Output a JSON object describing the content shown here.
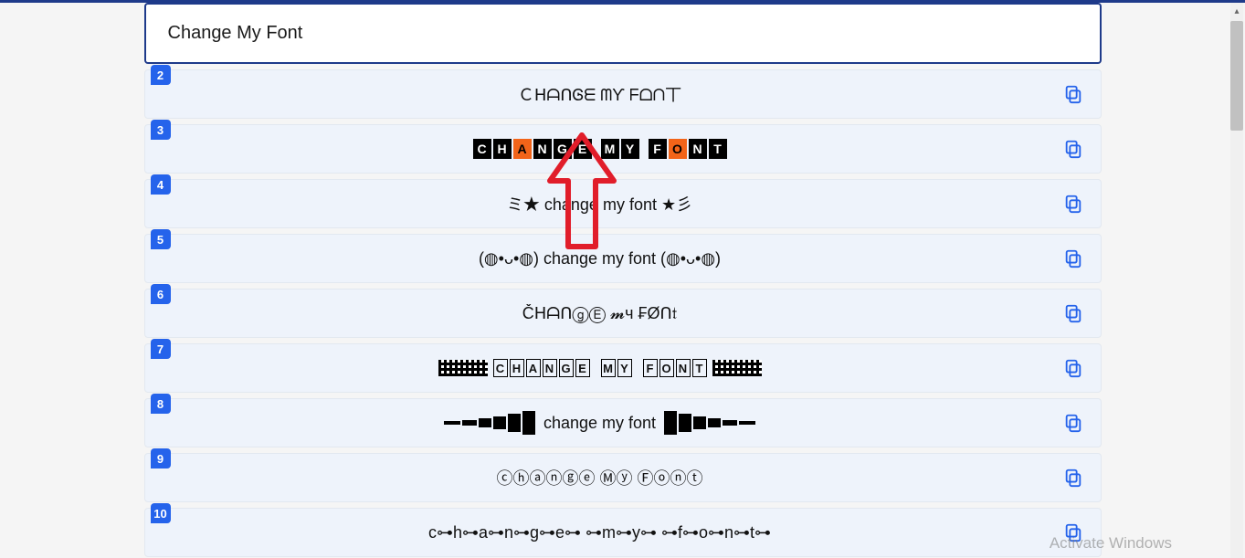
{
  "input": {
    "value": "Change My Font"
  },
  "rows": [
    {
      "num": "2",
      "text": "ＣᕼᗩᑎᎶᗴ ᗰƳ ᖴᗝᑎ丅"
    },
    {
      "num": "3",
      "text": ""
    },
    {
      "num": "4",
      "text": "ミ★ change my font ★彡"
    },
    {
      "num": "5",
      "text": "(◍•ᴗ•◍) change my font (◍•ᴗ•◍)"
    },
    {
      "num": "6",
      "text": "ČᕼᗩᑎⓖⒺ 𝓶ч ₣Øᑎ𝔱"
    },
    {
      "num": "7",
      "text": ""
    },
    {
      "num": "8",
      "text": "change my font"
    },
    {
      "num": "9",
      "text": "ⓒⓗⓐⓝⓖⓔ Ⓜⓨ Ⓕⓞⓝⓣ"
    },
    {
      "num": "10",
      "text": "c⊶h⊶a⊶n⊶g⊶e⊶ ⊶m⊶y⊶ ⊶f⊶o⊶n⊶t⊶"
    }
  ],
  "row3_letters": [
    {
      "c": "C",
      "o": false
    },
    {
      "c": "H",
      "o": false
    },
    {
      "c": "A",
      "o": true
    },
    {
      "c": "N",
      "o": false
    },
    {
      "c": "G",
      "o": false
    },
    {
      "c": "E",
      "o": false
    },
    {
      "c": " ",
      "o": false
    },
    {
      "c": "M",
      "o": false
    },
    {
      "c": "Y",
      "o": false
    },
    {
      "c": " ",
      "o": false
    },
    {
      "c": "F",
      "o": false
    },
    {
      "c": "O",
      "o": true
    },
    {
      "c": "N",
      "o": false
    },
    {
      "c": "T",
      "o": false
    }
  ],
  "row7_words": [
    "CHANGE",
    "MY",
    "FONT"
  ],
  "watermark": "Activate Windows"
}
